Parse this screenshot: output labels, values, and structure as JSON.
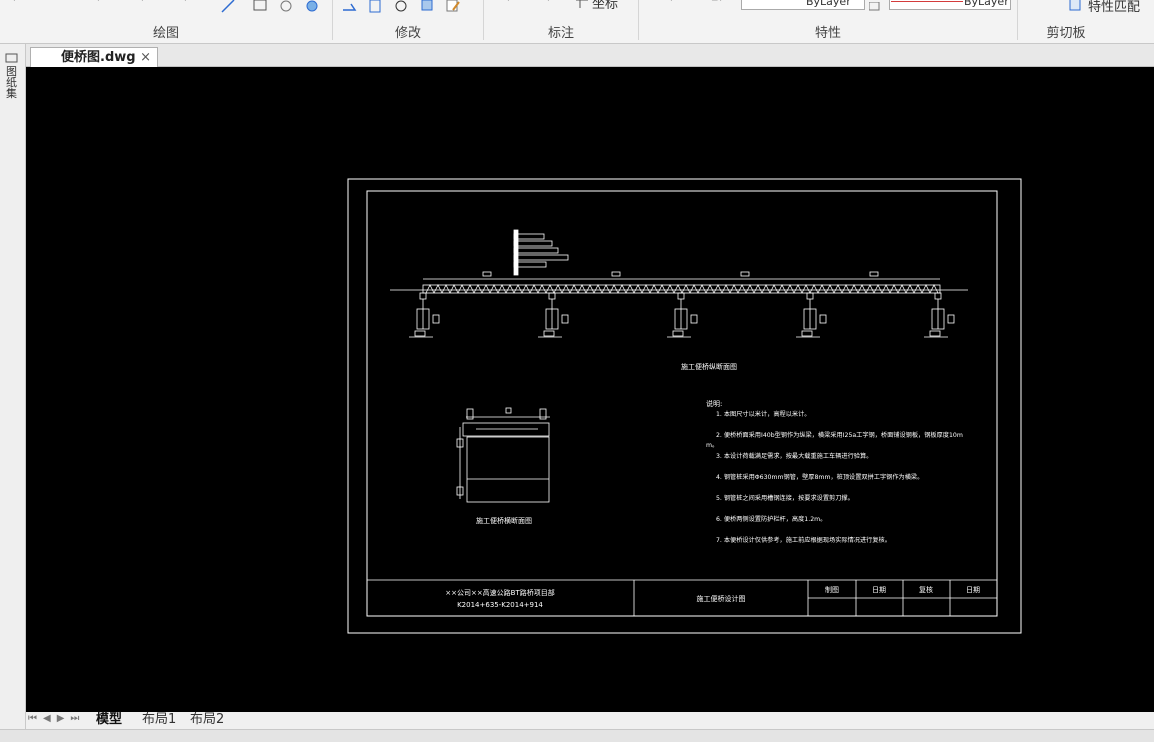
{
  "ribbon": {
    "groups": [
      {
        "label": "绘图"
      },
      {
        "label": "修改"
      },
      {
        "label": "标注"
      },
      {
        "label": "特性"
      },
      {
        "label": "剪切板"
      }
    ],
    "coordinate_label": "坐标",
    "linetype_value": "ByLayer",
    "color_value": "ByLayer",
    "match_properties": "特性匹配"
  },
  "document_tab": {
    "title": "便桥图.dwg",
    "close": "×"
  },
  "side_panel": {
    "label": "图纸集"
  },
  "layout_tabs": [
    {
      "label": "模型",
      "active": true
    },
    {
      "label": "布局1",
      "active": false
    },
    {
      "label": "布局2",
      "active": false
    }
  ],
  "drawing": {
    "elevation_caption": "施工便桥纵断面图",
    "section_caption": "施工便桥横断面图",
    "notes_title": "说明:",
    "notes": [
      "1. 本图尺寸以米计，高程以米计。",
      "2. 便桥桥面采用I40b型钢作为纵梁，横梁采用I25a工字钢，桥面铺设钢板，钢板厚度10mm。",
      "3. 本设计荷载满足需求，按最大载重施工车辆进行验算。",
      "4. 钢管桩采用Φ630mm钢管，壁厚8mm，桩顶设置双拼工字钢作为横梁。",
      "5. 钢管桩之间采用槽钢连接，按要求设置剪刀撑。",
      "6. 便桥两侧设置防护栏杆，高度1.2m。",
      "7. 本便桥设计仅供参考，施工前应根据现场实际情况进行复核。"
    ],
    "title_block": {
      "company_line1": "××公司××高速公路BT路桥项目部",
      "company_line2": "K2014+635-K2014+914",
      "drawing_title": "施工便桥设计图",
      "cells": [
        "制图",
        "日期",
        "复核",
        "日期"
      ]
    }
  }
}
